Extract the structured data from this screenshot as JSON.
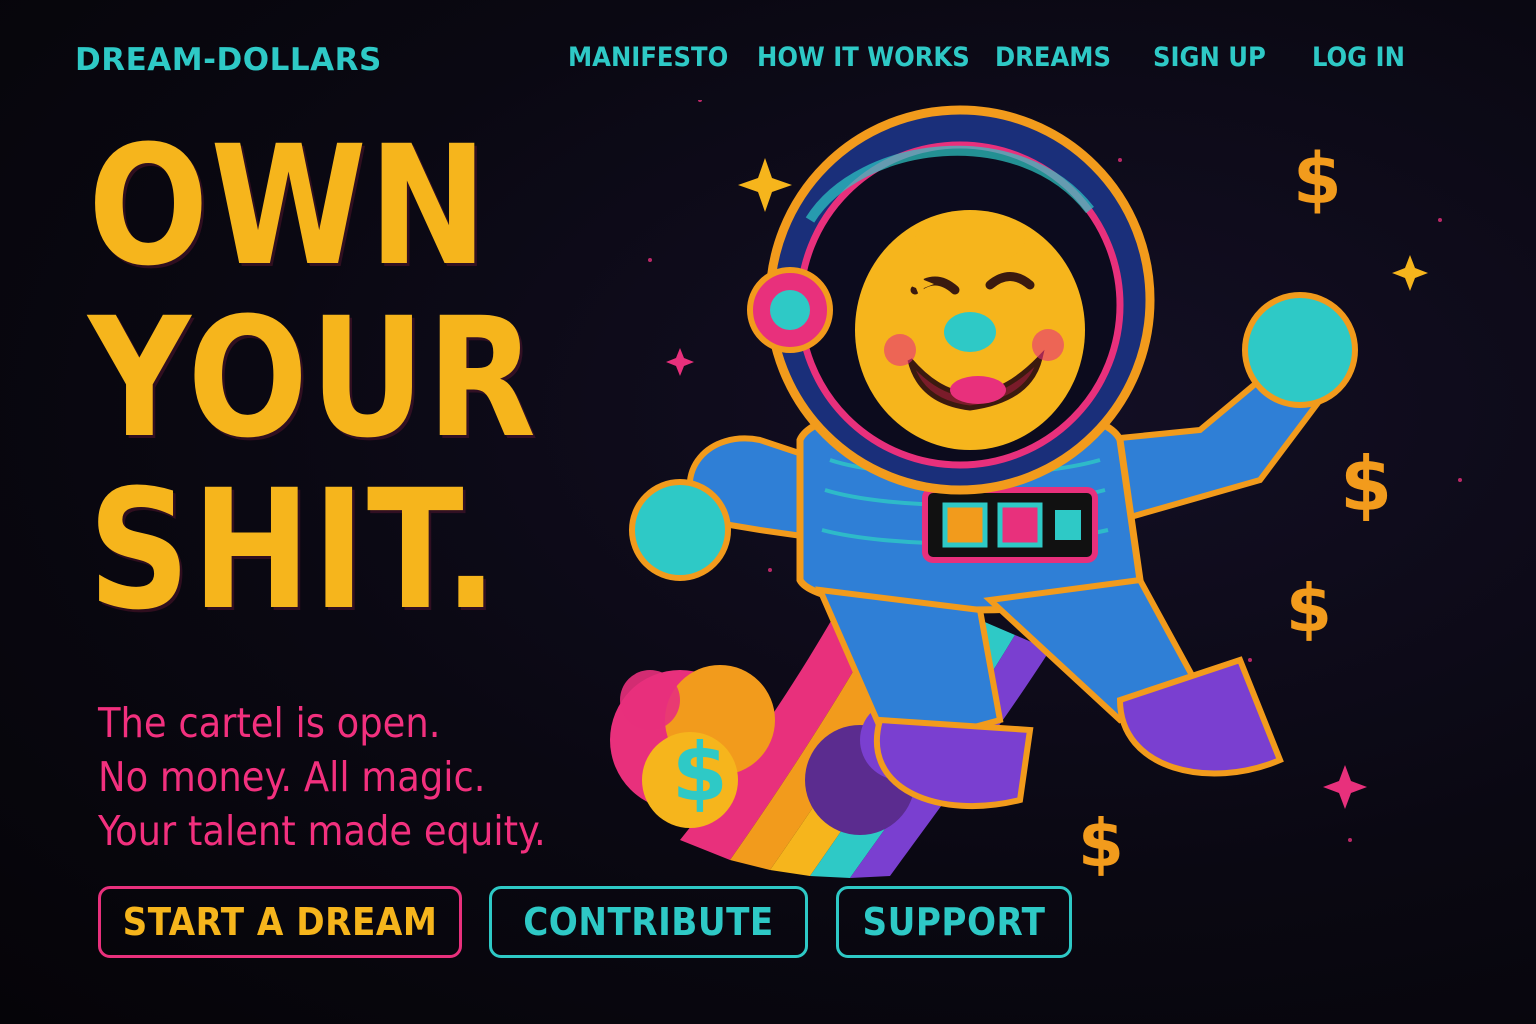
{
  "brand": {
    "logo_text": "DREAM-DOLLARS"
  },
  "nav": {
    "items": [
      {
        "label": "MANIFESTO"
      },
      {
        "label": "HOW IT WORKS"
      },
      {
        "label": "DREAMS"
      },
      {
        "label": "SIGN UP"
      },
      {
        "label": "LOG IN"
      }
    ]
  },
  "hero": {
    "headline": [
      "OWN",
      "YOUR",
      "SHIT."
    ],
    "tagline": [
      "The cartel is open.",
      "No money. All magic.",
      "Your talent made equity."
    ],
    "buttons": {
      "start": "START A DREAM",
      "contribute": "CONTRIBUTE",
      "support": "SUPPORT"
    },
    "illustration": {
      "subject_icon": "astronaut-icon",
      "decoration_icon": "dollar-sign-icon",
      "dollar_glyph": "$"
    }
  },
  "colors": {
    "background": "#07060b",
    "teal": "#2ec9c6",
    "yellow": "#f6b51c",
    "pink": "#e8307c",
    "orange": "#f29b1c"
  }
}
